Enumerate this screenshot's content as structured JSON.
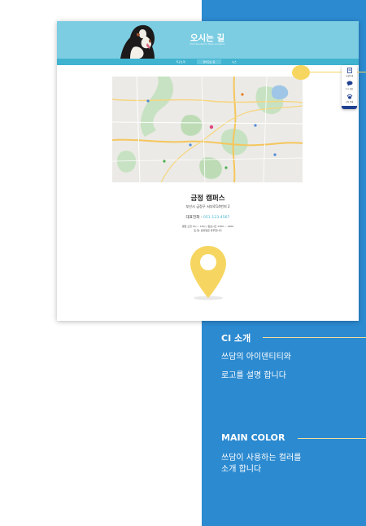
{
  "mockup": {
    "banner_title": "오시는 길",
    "banner_subtitle": "Find Ssodam's Dam Location",
    "subnav": [
      "학교소개",
      "찾아오는 길",
      "뉴스"
    ],
    "campus_title": "금정 캠퍼스",
    "campus_address": "부산시 금정구 서부로14번지 2",
    "phone_label": "대표전화 :",
    "phone_number": "051-123-4567",
    "hours_line1": "평일 오전 9시 ~ 18시 | 점심시간 1300 ~ 1400",
    "hours_line2": "토,일, 공휴일은 휴무합니다",
    "side_widget": {
      "items": [
        "시설안내",
        "1:1 상담",
        "교육 문의"
      ],
      "icons": [
        "document-icon",
        "chat-icon",
        "paw-icon"
      ]
    }
  },
  "sections": [
    {
      "title": "CI 소개",
      "lines": [
        "쓰담의 아이덴티티와",
        "로고를 설명 합니다"
      ]
    },
    {
      "title": "MAIN COLOR",
      "lines": [
        "쓰담이 사용하는 컬러를",
        "소개 합니다"
      ]
    }
  ],
  "colors": {
    "panel_blue": "#2c8ad0",
    "banner_cyan": "#7ccde2",
    "subnav_cyan": "#3fb3d0",
    "accent_yellow": "#f6d660",
    "section_rule": "#f0df9a"
  }
}
